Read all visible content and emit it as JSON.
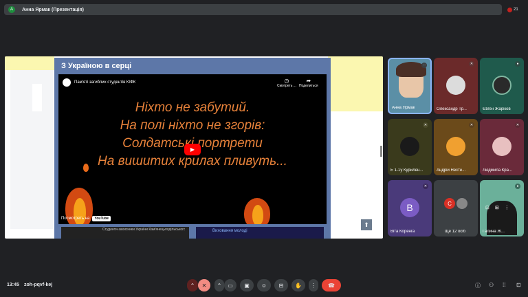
{
  "topbar": {
    "presenter_initial": "А",
    "presenter_title": "Анна Ярмак (Презентація)",
    "people_count": "21"
  },
  "slide": {
    "title": "З Україною в серці",
    "video": {
      "title": "Пам'яті загиблих студентів КІФК",
      "share_later": "Смотреть ...",
      "share": "Поделиться",
      "lines": [
        "Ніхто не забутий.",
        "На полі ніхто не згорів:",
        "Солдатські портрети",
        "На вишитих крилах пливуть..."
      ],
      "watch_on": "Посмотреть на",
      "youtube": "YouTube"
    },
    "next_thumb_1": "Студенти-захисники України Кам'янецьподільського ЛВНЗ «Бучач»",
    "next_thumb_2": "Виховання молоді"
  },
  "participants": [
    {
      "name": "Анна Ярмак",
      "muted": false
    },
    {
      "name": "Олександр Тр...",
      "muted": true
    },
    {
      "name": "Євген Жаріков",
      "muted": false
    },
    {
      "name": "Е 1-1у Курилен...",
      "muted": true
    },
    {
      "name": "Андрій Несте...",
      "muted": true
    },
    {
      "name": "Людмила Кра...",
      "muted": true
    },
    {
      "name": "Віта Коренга",
      "initial": "В",
      "muted": true
    },
    {
      "name": "Ще 12 осіб",
      "initial": "С"
    },
    {
      "name": "Галина Ж...",
      "muted": false
    }
  ],
  "bottom": {
    "time": "13:45",
    "meeting_code": "zoh-pqvf-kej"
  },
  "colors": {
    "end_call": "#ea4335",
    "mic_off": "#f28b82",
    "tile_bg_purple": "#6a4fa8"
  }
}
